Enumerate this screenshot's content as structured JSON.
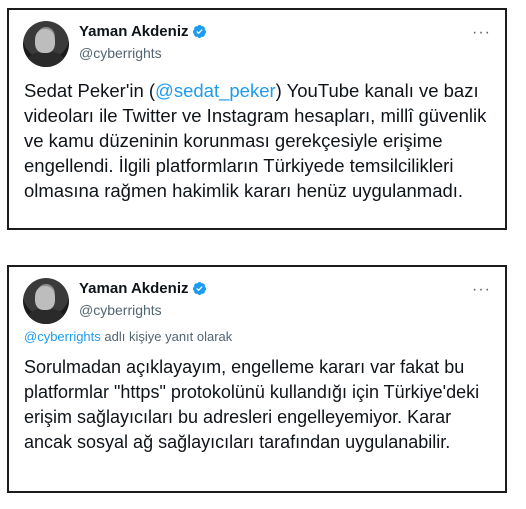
{
  "tweets": [
    {
      "author_name": "Yaman Akdeniz",
      "handle": "@cyberrights",
      "more_label": "···",
      "text_before": "Sedat Peker'in (",
      "mention": "@sedat_peker",
      "text_after": ") YouTube kanalı ve bazı videoları ile Twitter ve Instagram hesapları, millî güvenlik ve kamu düzeninin korunması gerekçesiyle erişime engellendi. İlgili platformların Türkiyede temsilcilikleri olmasına rağmen hakimlik kararı henüz uygulanmadı."
    },
    {
      "author_name": "Yaman Akdeniz",
      "handle": "@cyberrights",
      "more_label": "···",
      "reply_mention": "@cyberrights",
      "reply_text": " adlı kişiye yanıt olarak",
      "text": "Sorulmadan açıklayayım, engelleme kararı var fakat bu platformlar \"https\" protokolünü kullandığı için Türkiye'deki erişim sağlayıcıları bu adresleri engelleyemiyor. Karar ancak sosyal ağ sağlayıcıları tarafından uygulanabilir."
    }
  ],
  "colors": {
    "accent": "#1d9bf0",
    "text": "#0f1419",
    "muted": "#536471",
    "border": "#1c1c1c"
  },
  "icons": {
    "verified": "verified-badge-icon",
    "more": "more-options-icon"
  }
}
